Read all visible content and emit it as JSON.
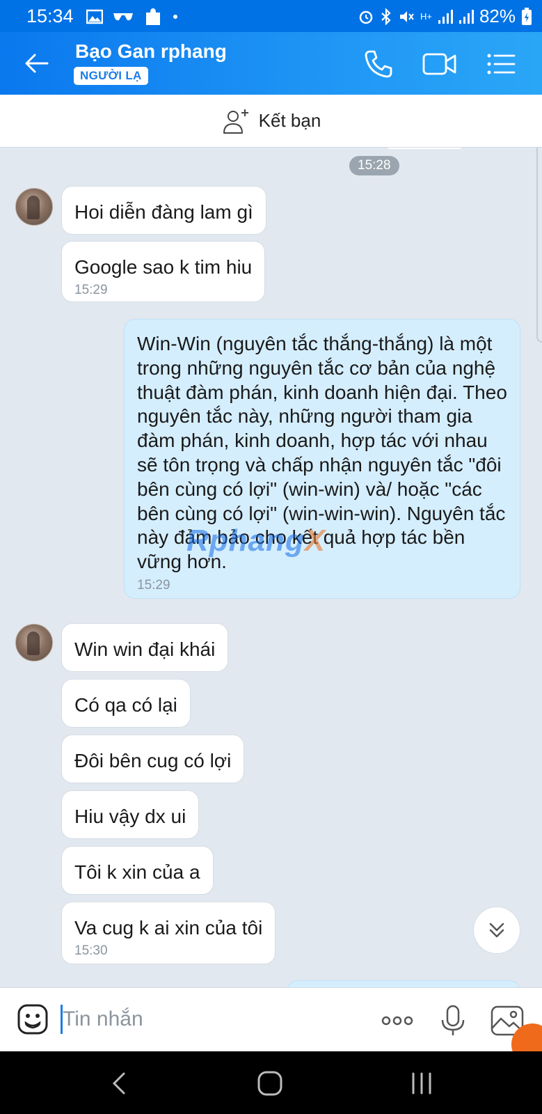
{
  "status_bar": {
    "time": "15:34",
    "battery": "82%",
    "network": "H+"
  },
  "header": {
    "contact_name": "Bạo Gan rphang",
    "badge": "NGƯỜI LẠ",
    "accent": "#1a7de8"
  },
  "friend_bar": {
    "label": "Kết bạn"
  },
  "chat": {
    "top_timestamp": "15:28",
    "messages_group_1": [
      {
        "text": "Hoi diễn đàng lam gì",
        "time": ""
      },
      {
        "text": "Google sao k tim hiu",
        "time": "15:29"
      }
    ],
    "my_message": {
      "text": "Win-Win (nguyên tắc thắng-thắng) là một trong những nguyên tắc cơ bản của nghệ thuật đàm phán, kinh doanh hiện đại. Theo nguyên tắc này, những người tham gia đàm phán, kinh doanh, hợp tác với nhau sẽ tôn trọng và chấp nhận nguyên tắc \"đôi bên cùng có lợi\" (win-win) và/ hoặc \"các bên cùng có lợi\" (win-win-win). Nguyên tắc này đảm bảo cho kết quả hợp tác bền vững hơn.",
      "time": "15:29"
    },
    "watermark": "Rphang",
    "watermark_x": "X",
    "messages_group_2": [
      {
        "text": "Win win đại khái",
        "time": ""
      },
      {
        "text": "Có qa có lại",
        "time": ""
      },
      {
        "text": "Đôi bên cug có lợi",
        "time": ""
      },
      {
        "text": "Hiu vậy dx ui",
        "time": ""
      },
      {
        "text": "Tôi k xin của a",
        "time": ""
      },
      {
        "text": "Va cug k ai xin của tôi",
        "time": "15:30"
      }
    ]
  },
  "input_bar": {
    "placeholder": "Tin nhắn"
  },
  "colors": {
    "header_start": "#0a78ee",
    "header_end": "#2aa6f7",
    "chat_bg": "#e2e8ef",
    "my_bubble": "#d5eefe",
    "other_bubble": "#ffffff"
  }
}
